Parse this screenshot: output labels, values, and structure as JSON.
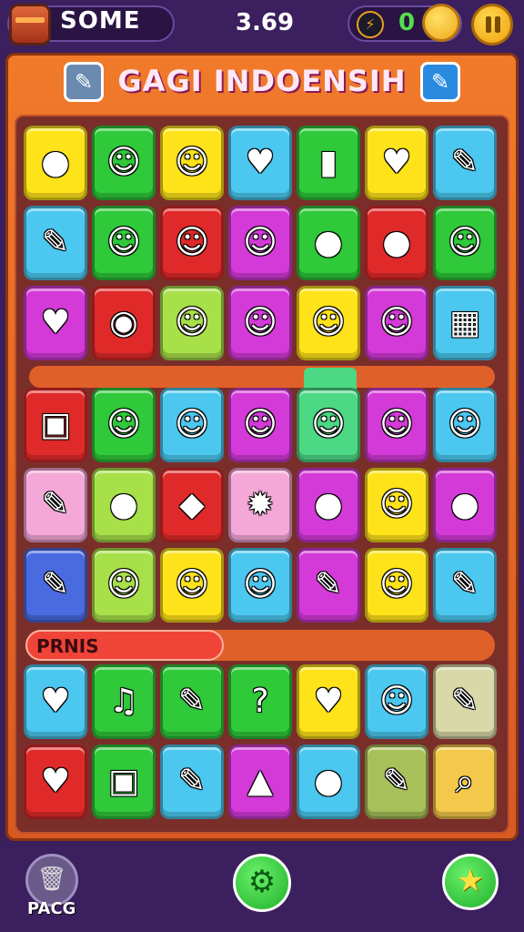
{
  "header": {
    "player_name": "SOME",
    "score": "3.69",
    "currency_count": "0"
  },
  "title": "GAGI INDOENSIH",
  "banner_label": "PRNIS",
  "footer": {
    "trash_label": "PACG"
  },
  "colors": {
    "background": "#3a1f5c",
    "frame_orange": "#e8672a",
    "accent_green": "#2fc43a",
    "accent_gold": "#f5b81f"
  },
  "board": {
    "rows": [
      [
        {
          "color": "#ffe31a",
          "icon": "apple-icon",
          "glyph": "●"
        },
        {
          "color": "#2fc93a",
          "icon": "robot-face-icon",
          "glyph": "☺"
        },
        {
          "color": "#ffe31a",
          "icon": "lemon-face-icon",
          "glyph": "☺"
        },
        {
          "color": "#4cc8f0",
          "icon": "heart-icon",
          "glyph": "♥"
        },
        {
          "color": "#2fc93a",
          "icon": "bottle-icon",
          "glyph": "▮"
        },
        {
          "color": "#ffe31a",
          "icon": "heart-icon",
          "glyph": "♥"
        },
        {
          "color": "#4cc8f0",
          "icon": "pencil-icon",
          "glyph": "✎"
        }
      ],
      [
        {
          "color": "#4cc8f0",
          "icon": "pencil-icon",
          "glyph": "✎"
        },
        {
          "color": "#2fc93a",
          "icon": "strawberry-face-icon",
          "glyph": "☺"
        },
        {
          "color": "#e02a2a",
          "icon": "blob-face-icon",
          "glyph": "☺"
        },
        {
          "color": "#d43ad8",
          "icon": "orange-face-icon",
          "glyph": "☺"
        },
        {
          "color": "#2fc93a",
          "icon": "balloon-icon",
          "glyph": "●"
        },
        {
          "color": "#e02a2a",
          "icon": "apple-icon",
          "glyph": "●"
        },
        {
          "color": "#2fc93a",
          "icon": "blob-face-icon",
          "glyph": "☺"
        }
      ],
      [
        {
          "color": "#d43ad8",
          "icon": "heart-icon",
          "glyph": "♥"
        },
        {
          "color": "#e02a2a",
          "icon": "eye-leaf-icon",
          "glyph": "◉"
        },
        {
          "color": "#a8e04a",
          "icon": "droplet-face-icon",
          "glyph": "☺"
        },
        {
          "color": "#d43ad8",
          "icon": "ghost-face-icon",
          "glyph": "☺"
        },
        {
          "color": "#ffe31a",
          "icon": "blob-face-icon",
          "glyph": "☺"
        },
        {
          "color": "#d43ad8",
          "icon": "lemon-face-icon",
          "glyph": "☺"
        },
        {
          "color": "#4cc8f0",
          "icon": "blocks-icon",
          "glyph": "▦"
        }
      ],
      [
        {
          "color": "#e02a2a",
          "icon": "sign-icon",
          "glyph": "▣"
        },
        {
          "color": "#2fc93a",
          "icon": "strawberry-face-icon",
          "glyph": "☺"
        },
        {
          "color": "#4cc8f0",
          "icon": "robot-face-icon",
          "glyph": "☺"
        },
        {
          "color": "#d43ad8",
          "icon": "blob-face-icon",
          "glyph": "☺"
        },
        {
          "color": "#4cd884",
          "icon": "lemon-face-icon",
          "glyph": "☺"
        },
        {
          "color": "#d43ad8",
          "icon": "robot-face-icon",
          "glyph": "☺"
        },
        {
          "color": "#4cc8f0",
          "icon": "robot-face-icon",
          "glyph": "☺"
        }
      ],
      [
        {
          "color": "#f4a8d8",
          "icon": "crayon-icon",
          "glyph": "✎"
        },
        {
          "color": "#a8e04a",
          "icon": "bag-icon",
          "glyph": "●"
        },
        {
          "color": "#e02a2a",
          "icon": "leaf-icon",
          "glyph": "◆"
        },
        {
          "color": "#f4a8d8",
          "icon": "gear-icon",
          "glyph": "✹"
        },
        {
          "color": "#d43ad8",
          "icon": "balloon-icon",
          "glyph": "●"
        },
        {
          "color": "#ffe31a",
          "icon": "lemon-face-icon",
          "glyph": "☺"
        },
        {
          "color": "#d43ad8",
          "icon": "apple-icon",
          "glyph": "●"
        }
      ],
      [
        {
          "color": "#4a6ae0",
          "icon": "crayon-icon",
          "glyph": "✎"
        },
        {
          "color": "#a8e04a",
          "icon": "strawberry-face-icon",
          "glyph": "☺"
        },
        {
          "color": "#ffe31a",
          "icon": "blob-face-icon",
          "glyph": "☺"
        },
        {
          "color": "#4cc8f0",
          "icon": "potato-face-icon",
          "glyph": "☺"
        },
        {
          "color": "#d43ad8",
          "icon": "pencil-icon",
          "glyph": "✎"
        },
        {
          "color": "#ffe31a",
          "icon": "blob-face-icon",
          "glyph": "☺"
        },
        {
          "color": "#4cc8f0",
          "icon": "crayon-icon",
          "glyph": "✎"
        }
      ],
      [
        {
          "color": "#4cc8f0",
          "icon": "heart-icon",
          "glyph": "♥"
        },
        {
          "color": "#2fc93a",
          "icon": "music-note-icon",
          "glyph": "♫"
        },
        {
          "color": "#2fc93a",
          "icon": "pencil-icon",
          "glyph": "✎"
        },
        {
          "color": "#2fc93a",
          "icon": "question-mark-icon",
          "glyph": "?"
        },
        {
          "color": "#ffe31a",
          "icon": "heart-icon",
          "glyph": "♥"
        },
        {
          "color": "#4cc8f0",
          "icon": "monster-face-icon",
          "glyph": "☺"
        },
        {
          "color": "#d8d8a8",
          "icon": "crayon-icon",
          "glyph": "✎"
        }
      ],
      [
        {
          "color": "#e02a2a",
          "icon": "heart-icon",
          "glyph": "♥"
        },
        {
          "color": "#2fc93a",
          "icon": "lock-icon",
          "glyph": "▣"
        },
        {
          "color": "#4cc8f0",
          "icon": "pencil-icon",
          "glyph": "✎"
        },
        {
          "color": "#d43ad8",
          "icon": "cone-icon",
          "glyph": "▲"
        },
        {
          "color": "#4cc8f0",
          "icon": "balloon-icon",
          "glyph": "●"
        },
        {
          "color": "#a8c05a",
          "icon": "pencil-icon",
          "glyph": "✎"
        },
        {
          "color": "#f4c84a",
          "icon": "magnifier-icon",
          "glyph": "⌕"
        }
      ]
    ]
  }
}
